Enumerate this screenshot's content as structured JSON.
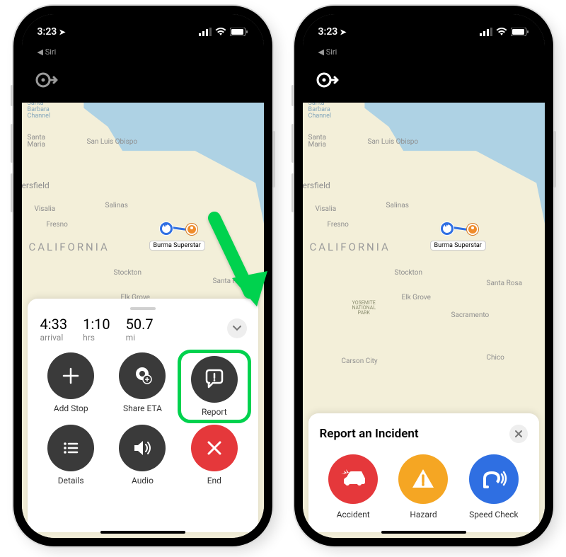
{
  "status_bar": {
    "time": "3:23",
    "back_indicator": "Siri"
  },
  "nav": {
    "direction_hint": "roundabout-right"
  },
  "map": {
    "state_label": "CALIFORNIA",
    "channel_label": "Santa\nBarbara\nChannel",
    "cities": {
      "santa_maria": "Santa\nMaria",
      "san_luis_obispo": "San Luis Obispo",
      "bakersfield": "ersfield",
      "visalia": "Visalia",
      "salinas": "Salinas",
      "fresno": "Fresno",
      "stockton": "Stockton",
      "elk_grove": "Elk Grove",
      "santa_rosa": "Santa Rosa",
      "sacramento": "Sacramento",
      "chico": "Chico",
      "carson_city": "Carson City"
    },
    "park_label": "YOSEMITE\nNATIONAL\nPARK",
    "destination_label": "Burma Superstar"
  },
  "trip": {
    "arrival_value": "4:33",
    "arrival_label": "arrival",
    "duration_value": "1:10",
    "duration_label": "hrs",
    "distance_value": "50.7",
    "distance_label": "mi"
  },
  "actions": {
    "add_stop": "Add Stop",
    "share_eta": "Share ETA",
    "report": "Report",
    "details": "Details",
    "audio": "Audio",
    "end": "End"
  },
  "incident_panel": {
    "title": "Report an Incident",
    "accident": "Accident",
    "hazard": "Hazard",
    "speed_check": "Speed Check"
  },
  "icons": {
    "roundabout": "⟳→",
    "plus": "+",
    "share": "share-pin",
    "report": "speech-alert",
    "details": "list",
    "audio": "speaker",
    "end": "✕",
    "chevron_down": "⌄",
    "close": "✕",
    "accident": "car-crash",
    "hazard": "warning",
    "speed_check": "radar"
  }
}
